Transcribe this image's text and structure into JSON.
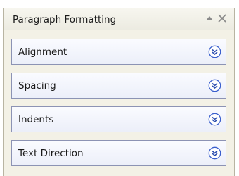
{
  "panel": {
    "title": "Paragraph Formatting",
    "header_icons": [
      "collapse-arrow-icon",
      "close-icon"
    ]
  },
  "sections": [
    {
      "label": "Alignment",
      "icon": "chevron-double-down-icon",
      "expanded": false
    },
    {
      "label": "Spacing",
      "icon": "chevron-double-down-icon",
      "expanded": false
    },
    {
      "label": "Indents",
      "icon": "chevron-double-down-icon",
      "expanded": false
    },
    {
      "label": "Text Direction",
      "icon": "chevron-double-down-icon",
      "expanded": false
    }
  ],
  "colors": {
    "panel_background": "#f3f1e6",
    "section_border": "#8c93b4",
    "expand_icon_ring": "#3a5fcd"
  }
}
